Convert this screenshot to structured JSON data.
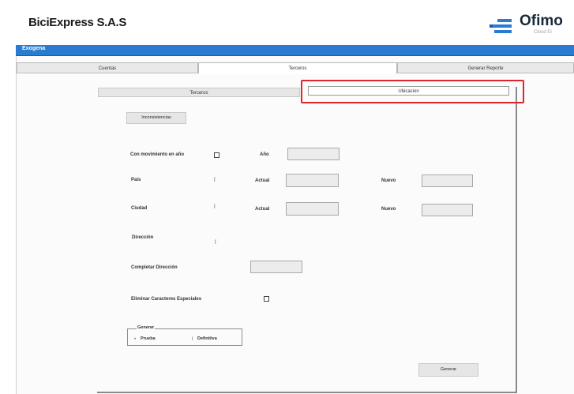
{
  "header": {
    "company": "BiciExpress S.A.S",
    "logo_text": "Ofimo",
    "logo_sub": "Cloud El"
  },
  "window": {
    "title": "Exogena"
  },
  "tabs": [
    {
      "label": "Cuentas",
      "active": false
    },
    {
      "label": "Terceros",
      "active": true
    },
    {
      "label": "Generar Reporte",
      "active": false
    }
  ],
  "subtabs": [
    {
      "label": "Terceros",
      "active": false
    },
    {
      "label": "Ubicacion",
      "active": true
    }
  ],
  "form": {
    "inconsistencias_label": "Inconsistencias",
    "con_movimiento_label": "Con movimiento en año",
    "anio_label": "Año",
    "pais_label": "País",
    "ciudad_label": "Ciudad",
    "actual_label": "Actual",
    "nuevo_label": "Nuevo",
    "direccion_label": "Dirección",
    "completar_direccion_label": "Completar Dirección",
    "eliminar_caracteres_label": "Eliminar Caracteres Especiales",
    "generar_group_label": "Generar",
    "prueba_label": "Prueba",
    "definitiva_label": "Definitiva",
    "generar_button_label": "Generar",
    "selected_mode": "Prueba"
  },
  "colors": {
    "titlebar": "#2a7cd0",
    "highlight": "#e0242e",
    "logo_bars": "#2a7cd0"
  },
  "icons": {
    "logo": "ofimatica-logo-icon",
    "checkbox": "checkbox-icon",
    "radio": "radio-icon"
  }
}
